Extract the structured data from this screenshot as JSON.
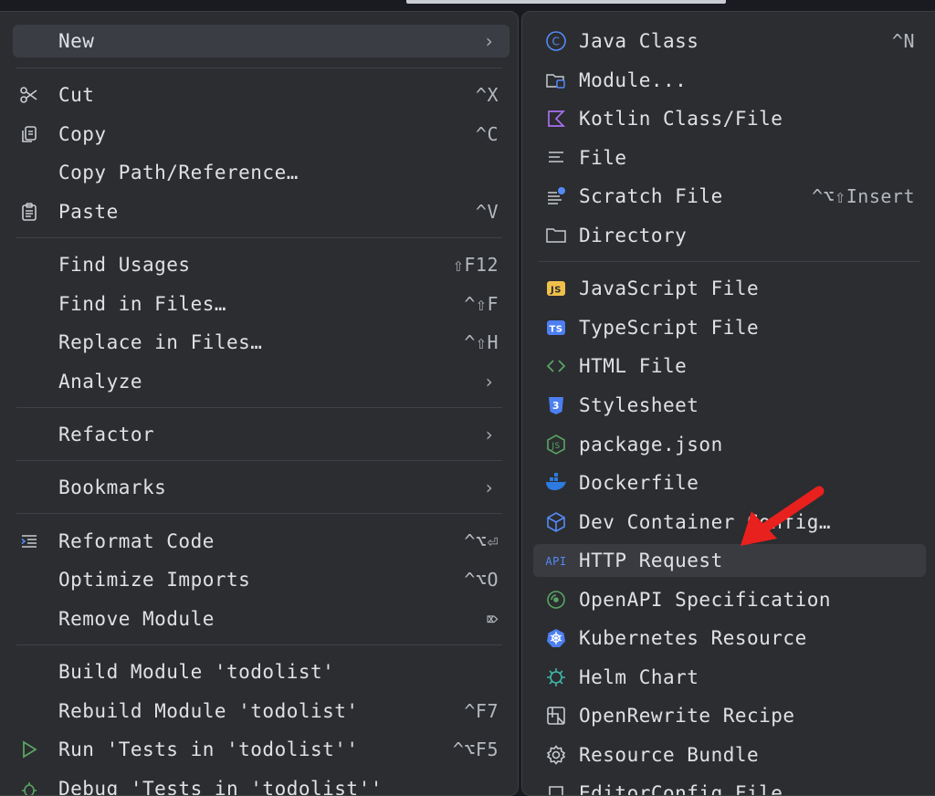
{
  "left_menu": {
    "new": {
      "label": "New",
      "arrow": "›"
    },
    "cut": {
      "label": "Cut",
      "shortcut": "^X"
    },
    "copy": {
      "label": "Copy",
      "shortcut": "^C"
    },
    "copy_path": {
      "label": "Copy Path/Reference…"
    },
    "paste": {
      "label": "Paste",
      "shortcut": "^V"
    },
    "find_usages": {
      "label": "Find Usages",
      "shortcut": "⇧F12"
    },
    "find_in_files": {
      "label": "Find in Files…",
      "shortcut": "^⇧F"
    },
    "replace_in_files": {
      "label": "Replace in Files…",
      "shortcut": "^⇧H"
    },
    "analyze": {
      "label": "Analyze",
      "arrow": "›"
    },
    "refactor": {
      "label": "Refactor",
      "arrow": "›"
    },
    "bookmarks": {
      "label": "Bookmarks",
      "arrow": "›"
    },
    "reformat": {
      "label": "Reformat Code",
      "shortcut": "^⌥⏎"
    },
    "optimize": {
      "label": "Optimize Imports",
      "shortcut": "^⌥O"
    },
    "remove_module": {
      "label": "Remove Module",
      "shortcut": "⌦"
    },
    "build": {
      "label": "Build Module 'todolist'"
    },
    "rebuild": {
      "label": "Rebuild Module 'todolist'",
      "shortcut": "^F7"
    },
    "run_tests": {
      "label": "Run 'Tests in 'todolist''",
      "shortcut": "^⌥F5"
    },
    "debug_tests": {
      "label": "Debug 'Tests in 'todolist''"
    }
  },
  "right_menu": {
    "java_class": {
      "label": "Java Class",
      "shortcut": "^N"
    },
    "module": {
      "label": "Module..."
    },
    "kotlin": {
      "label": "Kotlin Class/File"
    },
    "file": {
      "label": "File"
    },
    "scratch": {
      "label": "Scratch File",
      "shortcut": "^⌥⇧Insert"
    },
    "directory": {
      "label": "Directory"
    },
    "js_file": {
      "label": "JavaScript File"
    },
    "ts_file": {
      "label": "TypeScript File"
    },
    "html_file": {
      "label": "HTML File"
    },
    "stylesheet": {
      "label": "Stylesheet"
    },
    "package_json": {
      "label": "package.json"
    },
    "dockerfile": {
      "label": "Dockerfile"
    },
    "dev_container": {
      "label": "Dev Container Config…"
    },
    "http_request": {
      "label": "HTTP Request"
    },
    "openapi": {
      "label": "OpenAPI Specification"
    },
    "kubernetes": {
      "label": "Kubernetes Resource"
    },
    "helm": {
      "label": "Helm Chart"
    },
    "openrewrite": {
      "label": "OpenRewrite Recipe"
    },
    "resource_bundle": {
      "label": "Resource Bundle"
    },
    "extra": {
      "label": "EditorConfig File"
    }
  },
  "icons": {
    "js_badge": "JS",
    "ts_badge": "TS",
    "api_badge": "API",
    "html_glyph": "<>",
    "css_badge": "3"
  },
  "colors": {
    "accent_blue": "#548af7",
    "js_yellow": "#f0c14a",
    "kotlin_purple": "#a96ff0",
    "html_green": "#5aa464",
    "css_blue": "#4d7ff2",
    "docker_blue": "#2d7be0",
    "pointer_red": "#e8201e"
  }
}
